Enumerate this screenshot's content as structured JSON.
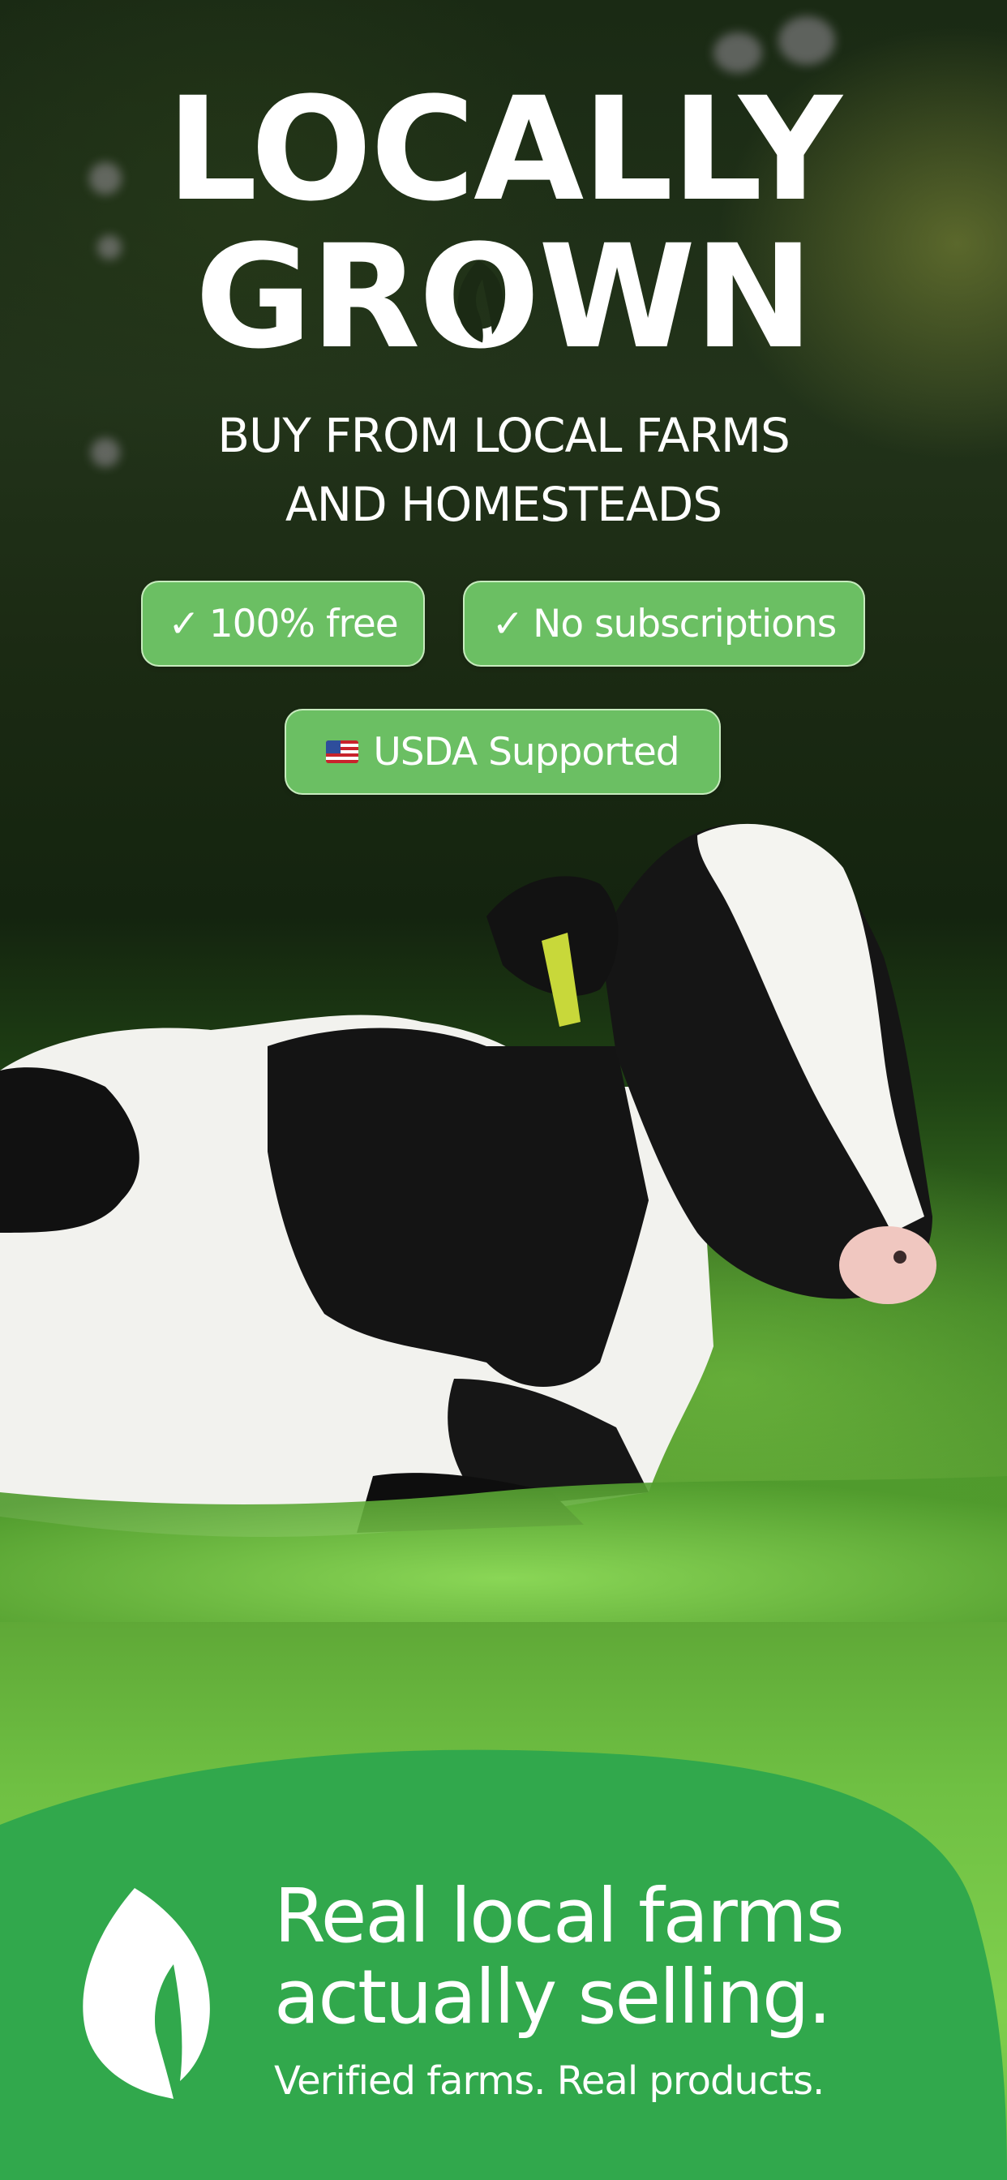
{
  "hero": {
    "title_line1": "LOCALLY",
    "title_line2_start": "GR",
    "title_line2_o": "O",
    "title_line2_end": "WN",
    "subtitle_line1": "BUY FROM LOCAL FARMS",
    "subtitle_line2": "AND HOMESTEADS"
  },
  "badges": [
    {
      "icon": "checkmark-icon",
      "icon_text": "✓",
      "label": "100% free"
    },
    {
      "icon": "checkmark-icon",
      "icon_text": "✓",
      "label": "No subscriptions"
    },
    {
      "icon": "us-flag-icon",
      "label": "USDA Supported"
    }
  ],
  "footer": {
    "headline_line1": "Real local farms",
    "headline_line2": "actually selling.",
    "tagline": "Verified farms. Real products."
  },
  "colors": {
    "brand_green": "#31a84c",
    "badge_green": "#6bbf63",
    "text": "#ffffff"
  }
}
